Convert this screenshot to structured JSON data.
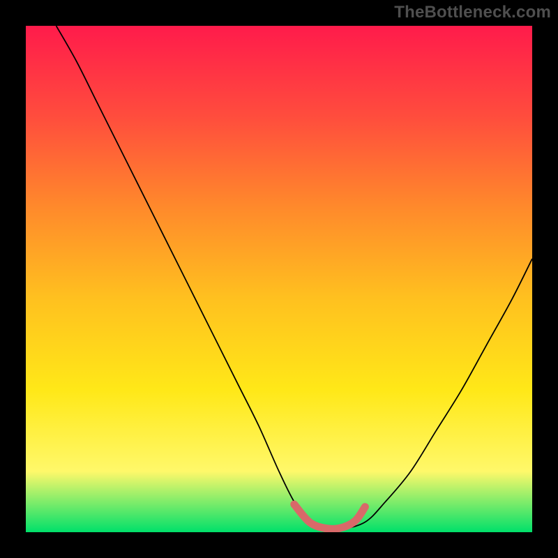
{
  "watermark_text": "TheBottleneck.com",
  "chart_data": {
    "type": "line",
    "title": "",
    "xlabel": "",
    "ylabel": "",
    "xlim": [
      0,
      100
    ],
    "ylim": [
      0,
      100
    ],
    "grid": false,
    "legend": false,
    "series": [
      {
        "name": "bottleneck-curve",
        "x": [
          6,
          10,
          14,
          18,
          22,
          26,
          30,
          34,
          38,
          42,
          46,
          50,
          53,
          56,
          59,
          62,
          67,
          71,
          76,
          81,
          86,
          91,
          96,
          100
        ],
        "values": [
          100,
          93,
          85,
          77,
          69,
          61,
          53,
          45,
          37,
          29,
          21,
          12,
          6,
          2,
          0.5,
          0.5,
          2,
          6,
          12,
          20,
          28,
          37,
          46,
          54
        ]
      }
    ],
    "highlight": {
      "name": "ideal-match-marker",
      "x": [
        53,
        56,
        59,
        62,
        65,
        67
      ],
      "values": [
        5.5,
        2,
        0.8,
        0.8,
        2.2,
        5
      ]
    },
    "background_gradient": [
      "#ff1b4b",
      "#ff4d3d",
      "#ff8a2b",
      "#ffc11f",
      "#ffe818",
      "#fff86a",
      "#00e06a"
    ]
  }
}
